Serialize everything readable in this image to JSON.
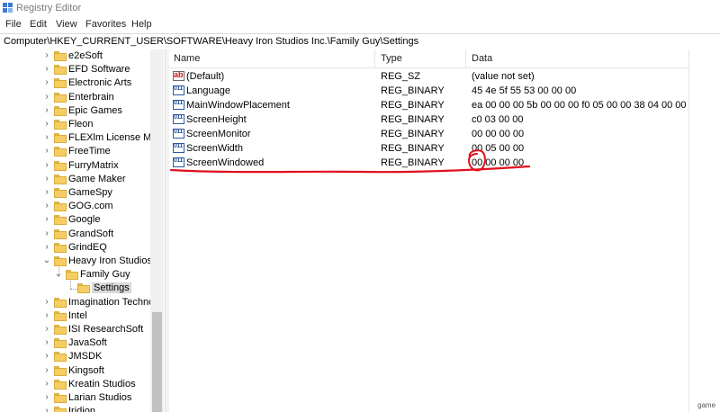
{
  "window": {
    "title": "Registry Editor"
  },
  "menu": [
    "File",
    "Edit",
    "View",
    "Favorites",
    "Help"
  ],
  "address": "Computer\\HKEY_CURRENT_USER\\SOFTWARE\\Heavy Iron Studios Inc.\\Family Guy\\Settings",
  "tree": {
    "items": [
      {
        "label": "e2eSoft",
        "state": "collapsed"
      },
      {
        "label": "EFD Software",
        "state": "collapsed"
      },
      {
        "label": "Electronic Arts",
        "state": "collapsed"
      },
      {
        "label": "Enterbrain",
        "state": "collapsed"
      },
      {
        "label": "Epic Games",
        "state": "collapsed"
      },
      {
        "label": "Fleon",
        "state": "collapsed"
      },
      {
        "label": "FLEXlm License Man",
        "state": "collapsed"
      },
      {
        "label": "FreeTime",
        "state": "collapsed"
      },
      {
        "label": "FurryMatrix",
        "state": "collapsed"
      },
      {
        "label": "Game Maker",
        "state": "collapsed"
      },
      {
        "label": "GameSpy",
        "state": "collapsed"
      },
      {
        "label": "GOG.com",
        "state": "collapsed"
      },
      {
        "label": "Google",
        "state": "collapsed"
      },
      {
        "label": "GrandSoft",
        "state": "collapsed"
      },
      {
        "label": "GrindEQ",
        "state": "collapsed"
      },
      {
        "label": "Heavy Iron Studios I",
        "state": "expanded"
      },
      {
        "label": "Family Guy",
        "state": "expanded"
      },
      {
        "label": "Settings",
        "state": "selected"
      },
      {
        "label": "Imagination Technol",
        "state": "collapsed"
      },
      {
        "label": "Intel",
        "state": "collapsed"
      },
      {
        "label": "ISI ResearchSoft",
        "state": "collapsed"
      },
      {
        "label": "JavaSoft",
        "state": "collapsed"
      },
      {
        "label": "JMSDK",
        "state": "collapsed"
      },
      {
        "label": "Kingsoft",
        "state": "collapsed"
      },
      {
        "label": "Kreatin Studios",
        "state": "collapsed"
      },
      {
        "label": "Larian Studios",
        "state": "collapsed"
      },
      {
        "label": "Iridion",
        "state": "collapsed"
      }
    ]
  },
  "list": {
    "headers": {
      "name": "Name",
      "type": "Type",
      "data": "Data"
    },
    "rows": [
      {
        "name": "(Default)",
        "type": "REG_SZ",
        "data": "(value not set)",
        "icon": "string-value-icon"
      },
      {
        "name": "Language",
        "type": "REG_BINARY",
        "data": "45 4e 5f 55 53 00 00 00",
        "icon": "binary-value-icon"
      },
      {
        "name": "MainWindowPlacement",
        "type": "REG_BINARY",
        "data": "ea 00 00 00 5b 00 00 00 f0 05 00 00 38 04 00 00",
        "icon": "binary-value-icon"
      },
      {
        "name": "ScreenHeight",
        "type": "REG_BINARY",
        "data": "c0 03 00 00",
        "icon": "binary-value-icon"
      },
      {
        "name": "ScreenMonitor",
        "type": "REG_BINARY",
        "data": "00 00 00 00",
        "icon": "binary-value-icon"
      },
      {
        "name": "ScreenWidth",
        "type": "REG_BINARY",
        "data": "00 05 00 00",
        "icon": "binary-value-icon"
      },
      {
        "name": "ScreenWindowed",
        "type": "REG_BINARY",
        "data": "00 00 00 00",
        "icon": "binary-value-icon"
      }
    ]
  },
  "icons": {
    "sz_glyph": "ab",
    "bin_glyph": "011"
  },
  "watermark": "game",
  "colors": {
    "annotation": "#e0101e",
    "folder": "#f5cd62",
    "selection": "#d9d9d9"
  }
}
